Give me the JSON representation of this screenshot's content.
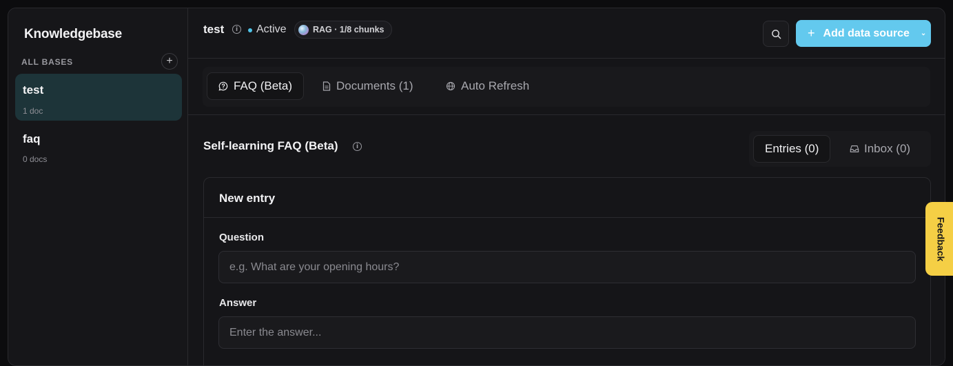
{
  "sidebar": {
    "title": "Knowledgebase",
    "section_label": "ALL BASES",
    "add_icon": "plus-icon",
    "items": [
      {
        "name": "test",
        "meta": "1 doc",
        "active": true
      },
      {
        "name": "faq",
        "meta": "0 docs",
        "active": false
      }
    ]
  },
  "header": {
    "title": "test",
    "status": "Active",
    "badge": "RAG · 1/8 chunks",
    "add_button_label": "Add data source"
  },
  "tabs": [
    {
      "label": "FAQ (Beta)",
      "icon": "message-question-icon",
      "active": true
    },
    {
      "label": "Documents (1)",
      "icon": "document-icon",
      "active": false
    },
    {
      "label": "Auto Refresh",
      "icon": "globe-icon",
      "active": false
    }
  ],
  "faq": {
    "heading": "Self-learning FAQ (Beta)",
    "segments": [
      {
        "label": "Entries (0)",
        "active": true
      },
      {
        "label": "Inbox (0)",
        "icon": "inbox-icon",
        "active": false
      }
    ]
  },
  "new_entry": {
    "title": "New entry",
    "question_label": "Question",
    "question_placeholder": "e.g. What are your opening hours?",
    "answer_label": "Answer",
    "answer_placeholder": "Enter the answer..."
  },
  "feedback_label": "Feedback",
  "colors": {
    "accent": "#63c9ee",
    "status_dot": "#4fc3e8",
    "active_item_bg": "#1d3439",
    "feedback_bg": "#f5cf45"
  }
}
